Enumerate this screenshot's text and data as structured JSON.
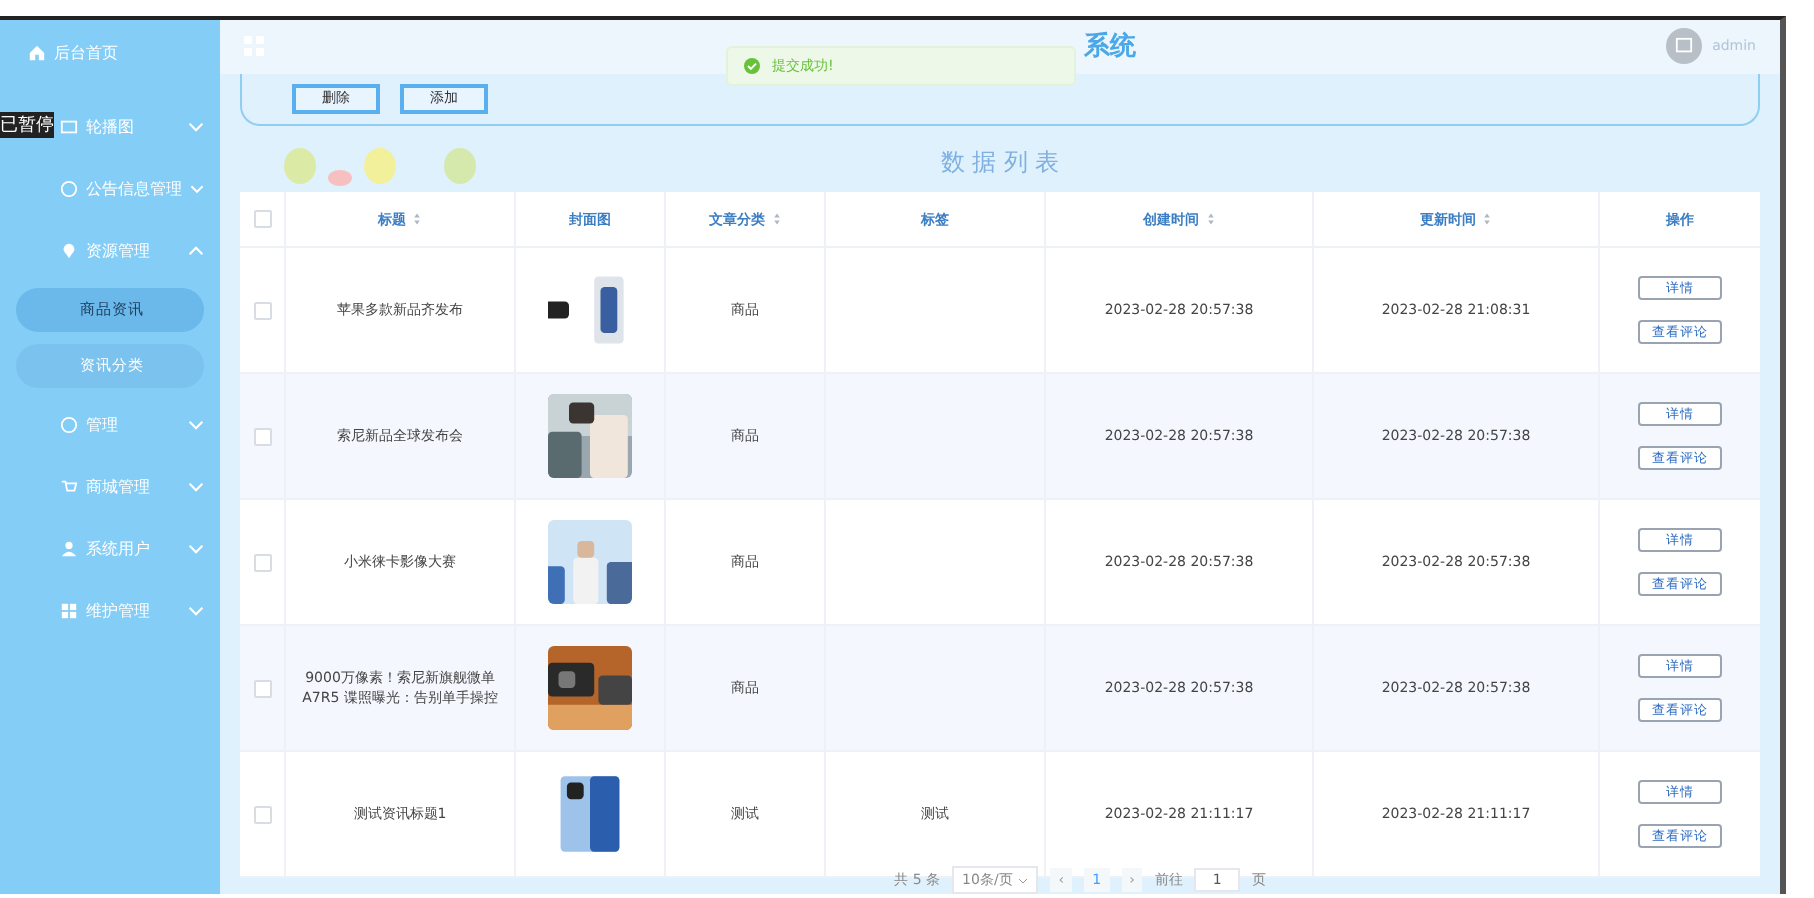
{
  "overlay_badge": "已暂停",
  "sidebar": {
    "items": [
      {
        "label": "后台首页"
      },
      {
        "label": "轮播图",
        "expanded": false
      },
      {
        "label": "公告信息管理",
        "expanded": false
      },
      {
        "label": "资源管理",
        "expanded": true,
        "children": [
          {
            "label": "商品资讯",
            "selected": true
          },
          {
            "label": "资讯分类",
            "selected": false
          }
        ]
      },
      {
        "label": "管理",
        "expanded": false
      },
      {
        "label": "商城管理",
        "expanded": false
      },
      {
        "label": "系统用户",
        "expanded": false
      },
      {
        "label": "维护管理",
        "expanded": false
      }
    ]
  },
  "header": {
    "title": "系统",
    "user": "admin"
  },
  "toast": {
    "message": "提交成功!"
  },
  "toolbar": {
    "buttons": [
      "删除",
      "添加"
    ]
  },
  "list_title": "数 据 列 表",
  "table": {
    "select_all_checked": false,
    "columns": [
      {
        "label": "标题",
        "sortable": true
      },
      {
        "label": "封面图",
        "sortable": false
      },
      {
        "label": "文章分类",
        "sortable": true
      },
      {
        "label": "标签",
        "sortable": false
      },
      {
        "label": "创建时间",
        "sortable": true
      },
      {
        "label": "更新时间",
        "sortable": true
      },
      {
        "label": "操作",
        "sortable": false
      }
    ],
    "rows": [
      {
        "checked": false,
        "title": "苹果多款新品齐发布",
        "category": "商品",
        "tag": "",
        "created": "2023-02-28 20:57:38",
        "updated": "2023-02-28 21:08:31",
        "actions": [
          "详情",
          "查看评论"
        ]
      },
      {
        "checked": false,
        "title": "索尼新品全球发布会",
        "category": "商品",
        "tag": "",
        "created": "2023-02-28 20:57:38",
        "updated": "2023-02-28 20:57:38",
        "actions": [
          "详情",
          "查看评论"
        ]
      },
      {
        "checked": false,
        "title": "小米徕卡影像大赛",
        "category": "商品",
        "tag": "",
        "created": "2023-02-28 20:57:38",
        "updated": "2023-02-28 20:57:38",
        "actions": [
          "详情",
          "查看评论"
        ]
      },
      {
        "checked": false,
        "title": "9000万像素！索尼新旗舰微单A7R5 谍照曝光：告别单手操控",
        "category": "商品",
        "tag": "",
        "created": "2023-02-28 20:57:38",
        "updated": "2023-02-28 20:57:38",
        "actions": [
          "详情",
          "查看评论"
        ]
      },
      {
        "checked": false,
        "title": "测试资讯标题1",
        "category": "测试",
        "tag": "测试",
        "created": "2023-02-28 21:11:17",
        "updated": "2023-02-28 21:11:17",
        "actions": [
          "详情",
          "查看评论"
        ]
      }
    ]
  },
  "pagination": {
    "total": "共 5 条",
    "page_size": "10条/页",
    "prev": "‹",
    "page": "1",
    "next": "›",
    "goto_label": "前往",
    "goto_value": "1",
    "goto_suffix": "页"
  }
}
